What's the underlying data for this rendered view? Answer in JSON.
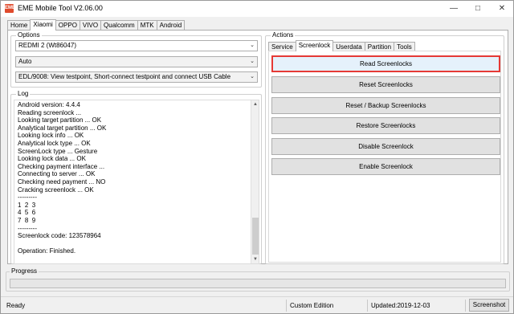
{
  "window": {
    "title": "EME Mobile Tool V2.06.00",
    "icon_label": "EME",
    "minimize_icon": "minimize-icon",
    "maximize_icon": "maximize-icon",
    "close_icon": "close-icon"
  },
  "top_tabs": [
    "Home",
    "Xiaomi",
    "OPPO",
    "VIVO",
    "Qualcomm",
    "MTK",
    "Android"
  ],
  "top_tab_active": "Xiaomi",
  "options": {
    "title": "Options",
    "model_select": "REDMI 2 (Wt86047)",
    "mode_select": "Auto",
    "connection_select": "EDL/9008: View testpoint, Short-connect testpoint and connect USB Cable"
  },
  "log": {
    "title": "Log",
    "lines": [
      "Android version: 4.4.4",
      "Reading screenlock ...",
      "Looking target partition ... OK",
      "Analytical target partition ... OK",
      "Looking lock info ... OK",
      "Analytical lock type ... OK",
      "ScreenLock type ... Gesture",
      "Looking lock data ... OK",
      "Checking payment interface ...",
      "Connecting to server ... OK",
      "Checking need payment ... NO",
      "Cracking screenlock ... OK",
      "---------",
      "1  2  3",
      "4  5  6",
      "7  8  9",
      "---------",
      "Screenlock code: 123578964",
      "",
      "Operation: Finished."
    ]
  },
  "actions": {
    "title": "Actions",
    "tabs": [
      "Service",
      "Screenlock",
      "Userdata",
      "Partition",
      "Tools"
    ],
    "active_tab": "Screenlock",
    "buttons": [
      "Read Screenlocks",
      "Reset Screenlocks",
      "Reset / Backup Screenlocks",
      "Restore Screenlocks",
      "Disable Screenlock",
      "Enable Screenlock"
    ],
    "highlight_color": "#e53935"
  },
  "progress": {
    "title": "Progress",
    "value_percent": 0
  },
  "status": {
    "state": "Ready",
    "edition": "Custom Edition",
    "updated": "Updated:2019-12-03",
    "screenshot_button": "Screenshot"
  }
}
